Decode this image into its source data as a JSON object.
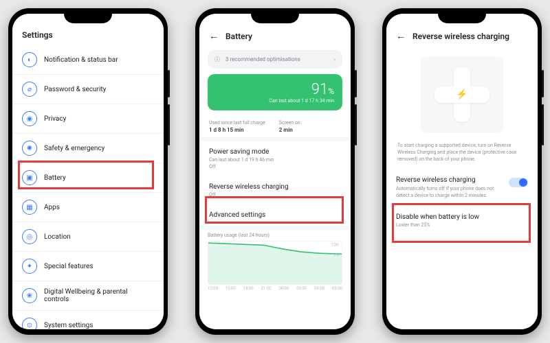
{
  "phone1": {
    "title": "Settings",
    "rows": [
      {
        "icon": "◐",
        "label": "Notification & status bar"
      },
      {
        "icon": "⌀",
        "label": "Password & security"
      },
      {
        "icon": "◉",
        "label": "Privacy"
      },
      {
        "icon": "✺",
        "label": "Safety & emergency"
      },
      {
        "icon": "▣",
        "label": "Battery"
      },
      {
        "icon": "▦",
        "label": "Apps"
      },
      {
        "icon": "◎",
        "label": "Location"
      },
      {
        "icon": "✦",
        "label": "Special features"
      },
      {
        "icon": "❀",
        "label": "Digital Wellbeing & parental controls"
      },
      {
        "icon": "⊙",
        "label": "System settings"
      }
    ]
  },
  "phone2": {
    "title": "Battery",
    "optimisations": "3 recommended optimisations",
    "battery_percent": "91",
    "percent_sign": "%",
    "battery_sub": "Can last about 1 d 17 h 34 min",
    "stat1_label": "Used since last full charge",
    "stat1_value": "1 d 8 h 15 min",
    "stat2_label": "Screen on",
    "stat2_value": "2 min",
    "psm_title": "Power saving mode",
    "psm_sub": "Can last about 1 d 19 h 46 min",
    "psm_state": "Off",
    "rwc_title": "Reverse wireless charging",
    "rwc_state": "Off",
    "adv": "Advanced settings",
    "chart_label": "Battery usage (last 24 hours)",
    "ticks": [
      "12:00",
      "15:00",
      "18:00",
      "21:00",
      "00:00",
      "03:00",
      "05:00",
      "08:00"
    ]
  },
  "phone3": {
    "title": "Reverse wireless charging",
    "desc": "To start charging a supported device, turn on Reverse Wireless Charging and place the device (protective case removed) on the back of your phone.",
    "rwc_title": "Reverse wireless charging",
    "rwc_sub": "Automatically turns off if your phone does not detect a device to charge within 2 minutes.",
    "disable_title": "Disable when battery is low",
    "disable_sub": "Lower than 25%"
  },
  "chart_data": {
    "type": "line",
    "title": "Battery usage (last 24 hours)",
    "xlabel": "",
    "ylabel": "%",
    "ylim": [
      0,
      100
    ],
    "x": [
      "12:00",
      "15:00",
      "18:00",
      "21:00",
      "00:00",
      "03:00",
      "05:00",
      "08:00"
    ],
    "values": [
      100,
      99,
      97,
      95,
      88,
      82,
      79,
      78
    ]
  }
}
